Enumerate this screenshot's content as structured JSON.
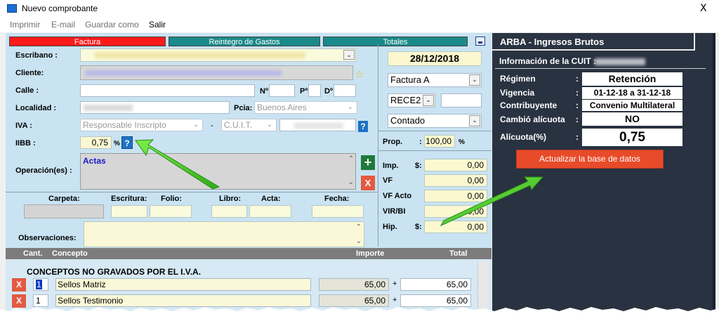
{
  "window": {
    "title": "Nuevo comprobante",
    "close": "X"
  },
  "menu": [
    "Imprimir",
    "E-mail",
    "Guardar como",
    "Salir"
  ],
  "tabs": {
    "factura": "Factura",
    "reintegro": "Reintegro de Gastos",
    "totales": "Totales"
  },
  "form": {
    "escribano_label": "Escribano :",
    "cliente_label": "Cliente:",
    "calle_label": "Calle :",
    "numero_label": "Nº",
    "piso_label": "Pº",
    "depto_label": "Dº",
    "localidad_label": "Localidad :",
    "provincia_label": "Pcia:",
    "provincia_value": "Buenos Aires",
    "iva_label": "IVA :",
    "iva_value": "Responsable Inscripto",
    "dash": "-",
    "cuit_type": "C.U.I.T.",
    "iibb_label": "IIBB :",
    "iibb_value": "0,75",
    "percent": "%",
    "help": "?",
    "operaciones_label": "Operación(es) :",
    "operaciones_value": "Actas",
    "add": "+",
    "remove": "X"
  },
  "side": {
    "date": "28/12/2018",
    "tipo": "Factura A",
    "rece": "RECE2",
    "pago": "Contado",
    "prop_label": "Prop.",
    "prop_value": "100,00",
    "percent": "%",
    "rows": [
      {
        "label": "Imp.",
        "currency": "$:",
        "value": "0,00"
      },
      {
        "label": "VF",
        "currency": "",
        "value": "0,00"
      },
      {
        "label": "VF Acto",
        "currency": "",
        "value": "0,00"
      },
      {
        "label": "VIR/BI",
        "currency": "",
        "value": "0,00"
      },
      {
        "label": "Hip.",
        "currency": "$:",
        "value": "0,00"
      }
    ]
  },
  "record": {
    "carpeta": "Carpeta:",
    "escritura": "Escritura:",
    "folio": "Folio:",
    "libro": "Libro:",
    "acta": "Acta:",
    "fecha": "Fecha:",
    "observaciones": "Observaciones:"
  },
  "concepts": {
    "headers": {
      "cant": "Cant.",
      "concepto": "Concepto",
      "importe": "Importe",
      "total": "Total"
    },
    "section_title": "CONCEPTOS NO GRAVADOS POR EL I.V.A.",
    "rows": [
      {
        "qty": "1",
        "name": "Sellos Matriz",
        "importe": "65,00",
        "op": "+",
        "total": "65,00"
      },
      {
        "qty": "1",
        "name": "Sellos Testimonio",
        "importe": "65,00",
        "op": "+",
        "total": "65,00"
      }
    ]
  },
  "arba": {
    "title": "ARBA - Ingresos Brutos",
    "cuit_label": "Información de la CUIT :",
    "rows": [
      {
        "label": "Régimen",
        "value": "Retención"
      },
      {
        "label": "Vigencia",
        "value": "01-12-18 a 31-12-18"
      },
      {
        "label": "Contribuyente",
        "value": "Convenio Multilateral"
      },
      {
        "label": "Cambió alícuota",
        "value": "NO"
      },
      {
        "label": "Alícuota(%)",
        "value": "0,75"
      }
    ],
    "colon": ":",
    "update_button": "Actualizar la base de datos"
  },
  "colors": {
    "accent_red": "#e84b2a",
    "panel_dark": "#293240",
    "form_bg": "#c9e3f2",
    "arrow_green": "#45d42a"
  }
}
